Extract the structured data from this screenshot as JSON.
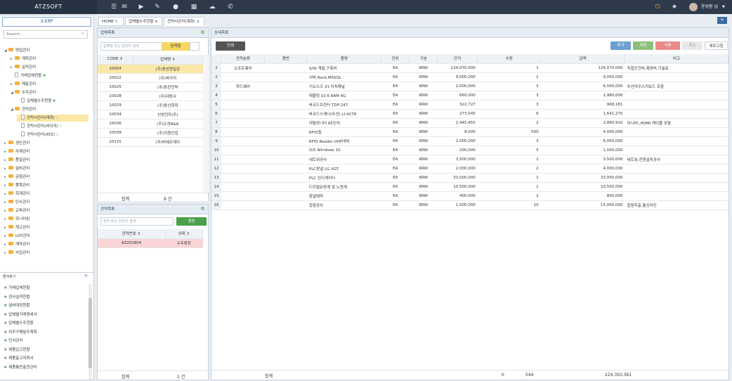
{
  "app": {
    "brand": "ATZSOFT",
    "user": "윤성원 님"
  },
  "tabs": [
    {
      "label": "HOME"
    },
    {
      "label": "업체별수주현황"
    },
    {
      "label": "견적서관리(대화)"
    }
  ],
  "sidebar": {
    "title": "X-ERP",
    "search_placeholder": "Search...",
    "tree": [
      {
        "label": "영업관리",
        "type": "folder",
        "open": true,
        "depth": 0
      },
      {
        "label": "계획관리",
        "type": "folder",
        "depth": 1
      },
      {
        "label": "실적관리",
        "type": "folder",
        "depth": 1
      },
      {
        "label": "거래업체현황",
        "type": "doc",
        "depth": 1,
        "star": true
      },
      {
        "label": "매출관리",
        "type": "folder",
        "depth": 1
      },
      {
        "label": "수주관리",
        "type": "folder",
        "open": true,
        "depth": 1
      },
      {
        "label": "업체별수주현황",
        "type": "doc",
        "depth": 2,
        "star": true
      },
      {
        "label": "견적관리",
        "type": "folder",
        "open": true,
        "depth": 1
      },
      {
        "label": "견적서관리(대화)",
        "type": "doc",
        "depth": 2,
        "star_o": true,
        "selected": true
      },
      {
        "label": "견적서관리(바이저)",
        "type": "doc",
        "depth": 2,
        "star_o": true
      },
      {
        "label": "견적서관리(ATZ)",
        "type": "doc",
        "depth": 2,
        "star_o": true
      },
      {
        "label": "생산관리",
        "type": "folder",
        "depth": 0
      },
      {
        "label": "자재관리",
        "type": "folder",
        "depth": 0
      },
      {
        "label": "품질관리",
        "type": "folder",
        "depth": 0
      },
      {
        "label": "설비관리",
        "type": "folder",
        "depth": 0
      },
      {
        "label": "금형관리",
        "type": "folder",
        "depth": 0
      },
      {
        "label": "품목관리",
        "type": "folder",
        "depth": 0
      },
      {
        "label": "회계관리",
        "type": "folder",
        "depth": 0
      },
      {
        "label": "인사관리",
        "type": "folder",
        "depth": 0
      },
      {
        "label": "교육관리",
        "type": "folder",
        "depth": 0
      },
      {
        "label": "모니터링",
        "type": "folder",
        "depth": 0
      },
      {
        "label": "재고관리",
        "type": "folder",
        "depth": 0
      },
      {
        "label": "LOT관리",
        "type": "folder",
        "depth": 0
      },
      {
        "label": "계약관리",
        "type": "folder",
        "depth": 0
      },
      {
        "label": "사업관리",
        "type": "folder",
        "depth": 0
      }
    ],
    "favorites_title": "즐겨찾기",
    "favorites": [
      "거래업체현황",
      "검사실적현황",
      "설비대장현황",
      "업체별거래명세서",
      "업체별수주현황",
      "외주구매발주계획",
      "인사관리",
      "제품입고현황",
      "제품출고의뢰서",
      "제품통반출현관리"
    ]
  },
  "vendor_list": {
    "title": "업체목록",
    "search_placeholder": "업체명 또는 담당자 검색",
    "search_button": "검색중",
    "columns": [
      "CODE",
      "업체명"
    ],
    "rows": [
      [
        "10004",
        "(주)동성정밀관"
      ],
      [
        "10022",
        "(주)바이저"
      ],
      [
        "10025",
        "(주)동진전력"
      ],
      [
        "10028",
        "(주)대동사"
      ],
      [
        "10029",
        "(주)동산화학"
      ],
      [
        "10034",
        "신영전자(주)"
      ],
      [
        "10036",
        "(주)오성R&A"
      ],
      [
        "10039",
        "(주)지원산업"
      ],
      [
        "10131",
        "(주)비에프케이"
      ]
    ],
    "footer_label": "합계",
    "footer_count": "9 건"
  },
  "quote_list": {
    "title": "견적목록",
    "search_placeholder": "일자 또는 담당자 검색",
    "create_button": "생성",
    "columns": [
      "견적번호",
      "상태"
    ],
    "rows": [
      [
        "AZ201804",
        "수주확정"
      ]
    ],
    "footer_label": "합계",
    "footer_count": "1 건"
  },
  "detail": {
    "title": "상세목록",
    "print_button": "인쇄",
    "add_button": "추가",
    "save_button": "저장",
    "delete_button": "삭제",
    "cancel_button": "취소",
    "refresh_button": "새로고침",
    "columns": [
      "",
      "견적분류",
      "품번",
      "품명",
      "단위",
      "구분",
      "단가",
      "수량",
      "금액",
      "비고"
    ],
    "rows": [
      [
        "1",
        "소프트웨어",
        "",
        "S/W 개발,구축비",
        "EA",
        "KRW",
        "124,070,000",
        "1",
        "124,070,000",
        "직접인건비,제경비,기술료"
      ],
      [
        "2",
        "",
        "",
        "서버 Rack,MSSQL",
        "EA",
        "KRW",
        "9,000,000",
        "1",
        "9,000,000",
        ""
      ],
      [
        "3",
        "하드웨어",
        "",
        "키오스크 21 터치패널",
        "EA",
        "KRW",
        "2,000,000",
        "3",
        "6,000,000",
        "무선마우스키보드 포함"
      ],
      [
        "4",
        "",
        "",
        "태블릿 10.6 RAM 4G",
        "EA",
        "KRW",
        "660,000",
        "3",
        "1,980,000",
        ""
      ],
      [
        "5",
        "",
        "",
        "바코드프린터 TDP-247",
        "EA",
        "KRW",
        "322,727",
        "3",
        "968,181",
        ""
      ],
      [
        "6",
        "",
        "",
        "바코드스캐너(무선) LI-4278",
        "EA",
        "KRW",
        "273,545",
        "6",
        "1,641,270",
        ""
      ],
      [
        "7",
        "",
        "",
        "대형모니터 65인치",
        "EA",
        "KRW",
        "1,445,455",
        "2",
        "2,890,910",
        "미니PC,HDMI 케이블 포함"
      ],
      [
        "8",
        "",
        "",
        "RFID칩",
        "EA",
        "KRW",
        "8,000",
        "500",
        "4,000,000",
        ""
      ],
      [
        "9",
        "",
        "",
        "RFID Reader UHF대역",
        "EA",
        "KRW",
        "2,000,000",
        "3",
        "6,000,000",
        ""
      ],
      [
        "10",
        "",
        "",
        "O/S Windows 10",
        "EA",
        "KRW",
        "200,000",
        "5",
        "1,000,000",
        ""
      ],
      [
        "11",
        "",
        "",
        "네트워공사",
        "EA",
        "KRW",
        "3,500,000",
        "1",
        "3,500,000",
        "네트워,전원설치공사"
      ],
      [
        "12",
        "",
        "",
        "PLC판넬 LG XGT",
        "EA",
        "KRW",
        "2,000,000",
        "2",
        "4,000,000",
        ""
      ],
      [
        "13",
        "",
        "",
        "PLC 인디케이터",
        "EA",
        "KRW",
        "33,000,000",
        "1",
        "33,000,000",
        ""
      ],
      [
        "14",
        "",
        "",
        "디지털유량계 및 노청계",
        "EA",
        "KRW",
        "10,500,000",
        "1",
        "10,500,000",
        ""
      ],
      [
        "15",
        "",
        "",
        "판넬제작",
        "EA",
        "KRW",
        "400,000",
        "2",
        "800,000",
        ""
      ],
      [
        "16",
        "",
        "",
        "접점공사",
        "EA",
        "KRW",
        "1,500,000",
        "10",
        "15,000,000",
        "접점추출,통신라인"
      ]
    ],
    "footer_label": "합계",
    "footer_price": "0",
    "footer_qty": "544",
    "footer_amount": "224,350,361"
  }
}
